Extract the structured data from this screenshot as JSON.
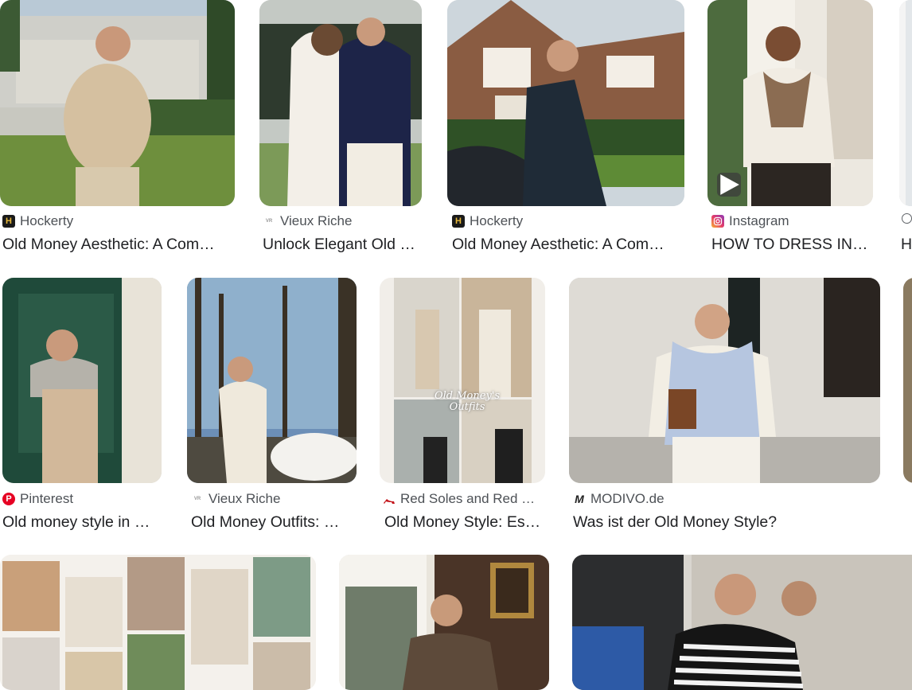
{
  "results": [
    {
      "source": "Hockerty",
      "icon": "hockerty-icon",
      "title": "Old Money Aesthetic: A Com…"
    },
    {
      "source": "Vieux Riche",
      "icon": "vieux-riche-icon",
      "title": "Unlock Elegant Old …"
    },
    {
      "source": "Hockerty",
      "icon": "hockerty-icon",
      "title": "Old Money Aesthetic: A Com…"
    },
    {
      "source": "Instagram",
      "icon": "instagram-icon",
      "title": "HOW TO DRESS IN …"
    },
    {
      "source": "Pinterest",
      "icon": "pinterest-icon",
      "title": "Old money style in …"
    },
    {
      "source": "Vieux Riche",
      "icon": "vieux-riche-icon",
      "title": "Old Money Outfits: …"
    },
    {
      "source": "Red Soles and Red …",
      "icon": "red-heel-icon",
      "title": "Old Money Style: Es…"
    },
    {
      "source": "MODIVO.de",
      "icon": "modivo-icon",
      "title": "Was ist der Old Money Style?"
    },
    {
      "source": "",
      "icon": "globe-icon",
      "title": "H"
    }
  ],
  "collage_text": "Old Money's Outfits",
  "colors": {
    "source_text": "#4d5156",
    "title_text": "#202124",
    "hockerty_brand": "#1a1a1a",
    "pinterest_brand": "#e60023",
    "red_soles_brand": "#c4161c"
  }
}
